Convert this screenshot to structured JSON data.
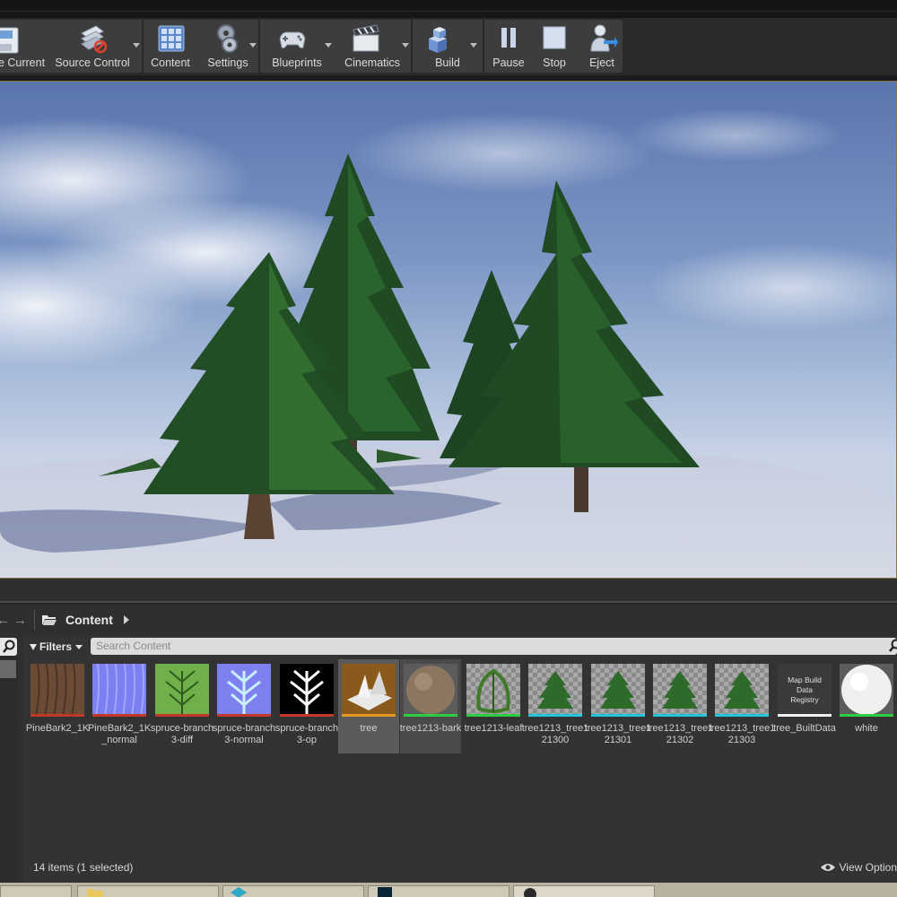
{
  "toolbar": {
    "items": [
      {
        "label": "e Current",
        "icon": "save-icon"
      },
      {
        "label": "Source Control",
        "icon": "source-control-icon",
        "dropdown": true
      },
      {
        "label": "Content",
        "icon": "content-icon"
      },
      {
        "label": "Settings",
        "icon": "settings-gear-icon",
        "dropdown": true
      },
      {
        "label": "Blueprints",
        "icon": "blueprints-gamepad-icon",
        "dropdown": true
      },
      {
        "label": "Cinematics",
        "icon": "cinematics-clapper-icon",
        "dropdown": true
      },
      {
        "label": "Build",
        "icon": "build-cubes-icon",
        "dropdown": true
      },
      {
        "label": "Pause",
        "icon": "pause-icon"
      },
      {
        "label": "Stop",
        "icon": "stop-icon"
      },
      {
        "label": "Eject",
        "icon": "eject-person-icon"
      }
    ]
  },
  "viewport": {
    "scene": "pine-trees-on-snow"
  },
  "content_browser": {
    "path": "Content",
    "filters_label": "Filters",
    "search_placeholder": "Search Content",
    "assets": [
      {
        "label": "PineBark2_1K",
        "bar_color": "#c0392b",
        "thumb": "bark"
      },
      {
        "label": "PineBark2_1K_normal",
        "bar_color": "#c0392b",
        "thumb": "normal"
      },
      {
        "label": "spruce-branch3-diff",
        "bar_color": "#c0392b",
        "thumb": "branch-diff"
      },
      {
        "label": "spruce-branch3-normal",
        "bar_color": "#c0392b",
        "thumb": "branch-normal"
      },
      {
        "label": "spruce-branch3-op",
        "bar_color": "#c0392b",
        "thumb": "branch-opacity"
      },
      {
        "label": "tree",
        "bar_color": "#e39a23",
        "thumb": "level",
        "selected": true
      },
      {
        "label": "tree1213-bark",
        "bar_color": "#2ecc40",
        "thumb": "bark-sphere",
        "hover": true
      },
      {
        "label": "tree1213-leaf",
        "bar_color": "#2ecc40",
        "thumb": "leaf"
      },
      {
        "label": "tree1213_tree121300",
        "bar_color": "#22c4d8",
        "thumb": "tree-mesh"
      },
      {
        "label": "tree1213_tree121301",
        "bar_color": "#22c4d8",
        "thumb": "tree-mesh"
      },
      {
        "label": "tree1213_tree121302",
        "bar_color": "#22c4d8",
        "thumb": "tree-mesh"
      },
      {
        "label": "tree1213_tree121303",
        "bar_color": "#22c4d8",
        "thumb": "tree-mesh"
      },
      {
        "label": "tree_BuiltData",
        "bar_color": "#f2f2f2",
        "thumb": "builtdata",
        "thumb_text": "Map Build Data Registry"
      },
      {
        "label": "white",
        "bar_color": "#2ecc40",
        "thumb": "white-sphere"
      }
    ],
    "status": "14 items (1 selected)",
    "view_options": "View Option"
  },
  "colors": {
    "accent_selected": "#e39a23",
    "panel_bg": "#2f2f2f"
  }
}
